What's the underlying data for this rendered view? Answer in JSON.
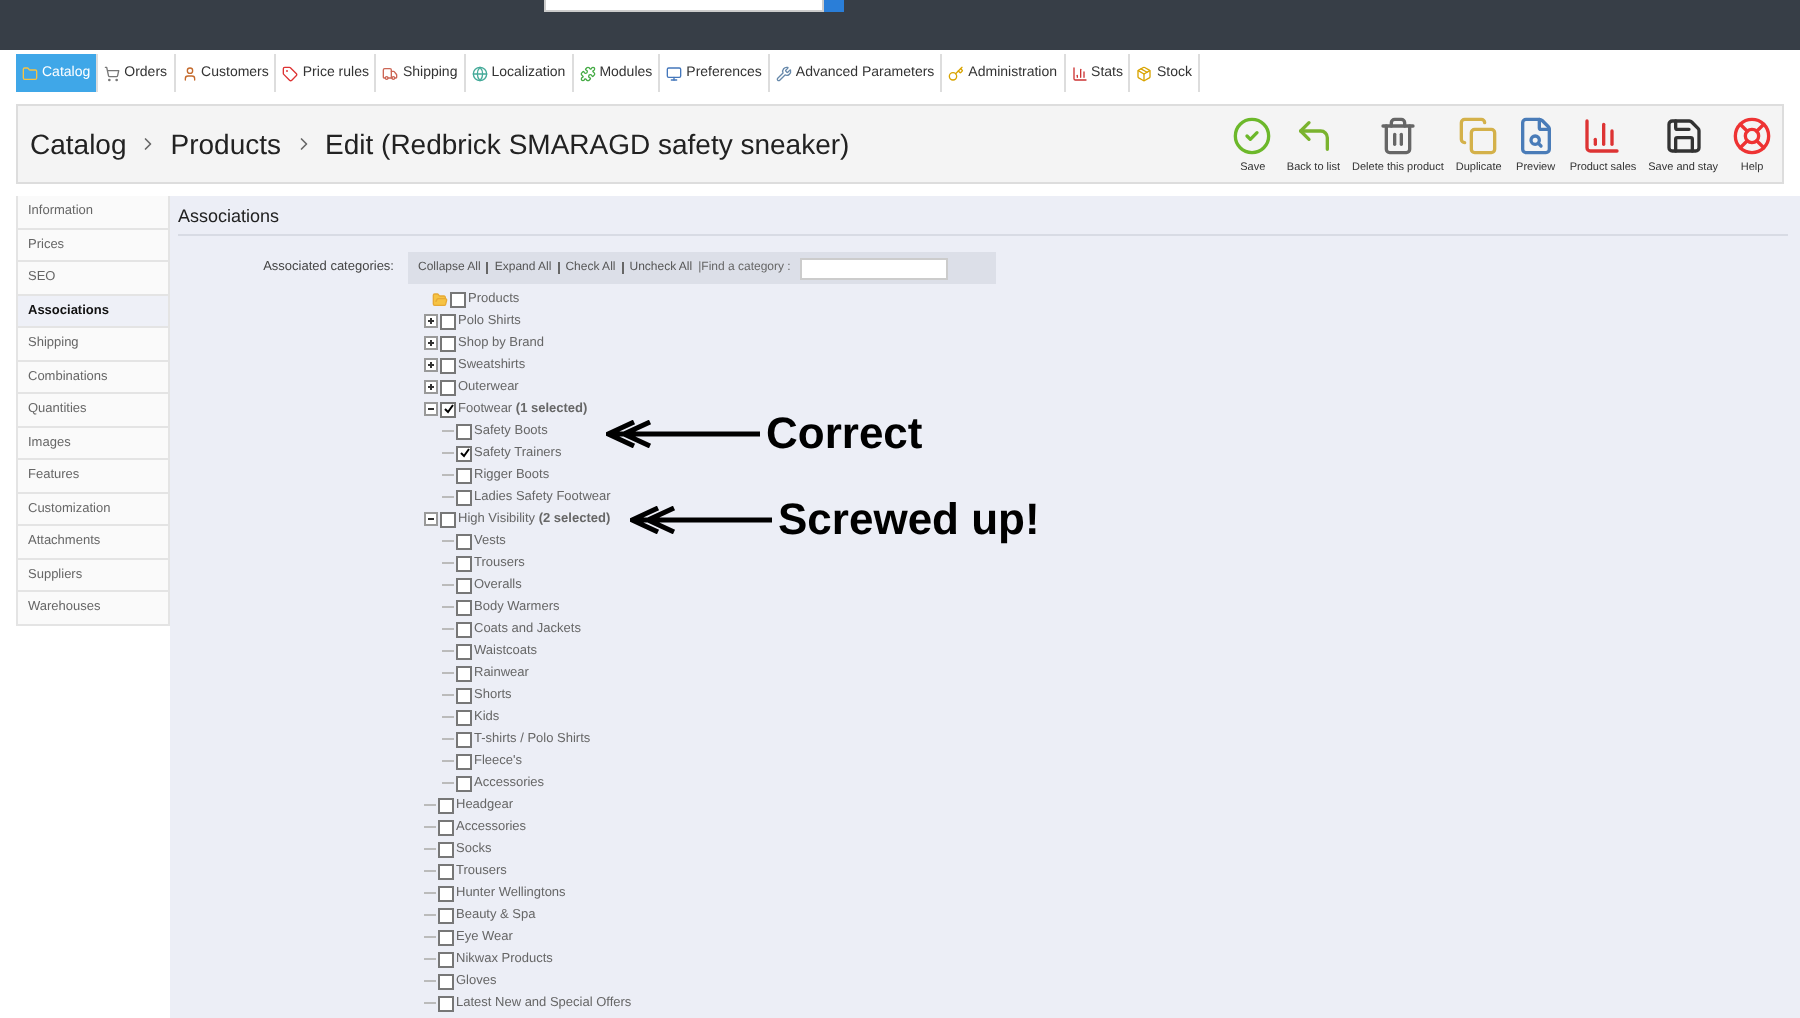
{
  "nav_tabs": [
    {
      "label": "Catalog",
      "selected": true
    },
    {
      "label": "Orders",
      "selected": false
    },
    {
      "label": "Customers",
      "selected": false
    },
    {
      "label": "Price rules",
      "selected": false
    },
    {
      "label": "Shipping",
      "selected": false
    },
    {
      "label": "Localization",
      "selected": false
    },
    {
      "label": "Modules",
      "selected": false
    },
    {
      "label": "Preferences",
      "selected": false
    },
    {
      "label": "Advanced Parameters",
      "selected": false
    },
    {
      "label": "Administration",
      "selected": false
    },
    {
      "label": "Stats",
      "selected": false
    },
    {
      "label": "Stock",
      "selected": false
    }
  ],
  "breadcrumb": [
    "Catalog",
    "Products",
    "Edit (Redbrick SMARAGD safety sneaker)"
  ],
  "toolbar": [
    "Save",
    "Back to list",
    "Delete this product",
    "Duplicate",
    "Preview",
    "Product sales",
    "Save and stay",
    "Help"
  ],
  "sidebar": [
    {
      "label": "Information",
      "selected": false
    },
    {
      "label": "Prices",
      "selected": false
    },
    {
      "label": "SEO",
      "selected": false
    },
    {
      "label": "Associations",
      "selected": true
    },
    {
      "label": "Shipping",
      "selected": false
    },
    {
      "label": "Combinations",
      "selected": false
    },
    {
      "label": "Quantities",
      "selected": false
    },
    {
      "label": "Images",
      "selected": false
    },
    {
      "label": "Features",
      "selected": false
    },
    {
      "label": "Customization",
      "selected": false
    },
    {
      "label": "Attachments",
      "selected": false
    },
    {
      "label": "Suppliers",
      "selected": false
    },
    {
      "label": "Warehouses",
      "selected": false
    }
  ],
  "section_title": "Associations",
  "field_label": "Associated categories:",
  "tree_actions": [
    "Collapse All",
    "Expand All",
    "Check All",
    "Uncheck All"
  ],
  "find_label": "|Find a category :",
  "tree": {
    "label": "Products",
    "checked": false,
    "children": [
      {
        "label": "Polo Shirts",
        "checked": false,
        "expanded": false
      },
      {
        "label": "Shop by Brand",
        "checked": false,
        "expanded": false
      },
      {
        "label": "Sweatshirts",
        "checked": false,
        "expanded": false
      },
      {
        "label": "Outerwear",
        "checked": false,
        "expanded": false
      },
      {
        "label": "Footwear **(1 selected)**",
        "checked": true,
        "expanded": true,
        "children": [
          {
            "label": "Safety Boots",
            "checked": false
          },
          {
            "label": "Safety Trainers",
            "checked": true
          },
          {
            "label": "Rigger Boots",
            "checked": false
          },
          {
            "label": "Ladies Safety Footwear",
            "checked": false
          }
        ]
      },
      {
        "label": "High Visibility **(2 selected)**",
        "checked": false,
        "expanded": true,
        "children": [
          {
            "label": "Vests",
            "checked": false
          },
          {
            "label": "Trousers",
            "checked": false
          },
          {
            "label": "Overalls",
            "checked": false
          },
          {
            "label": "Body Warmers",
            "checked": false
          },
          {
            "label": "Coats and Jackets",
            "checked": false
          },
          {
            "label": "Waistcoats",
            "checked": false
          },
          {
            "label": "Rainwear",
            "checked": false
          },
          {
            "label": "Shorts",
            "checked": false
          },
          {
            "label": "Kids",
            "checked": false
          },
          {
            "label": "T-shirts / Polo Shirts",
            "checked": false
          },
          {
            "label": "Fleece's",
            "checked": false
          },
          {
            "label": "Accessories",
            "checked": false
          }
        ]
      },
      {
        "label": "Headgear",
        "checked": false
      },
      {
        "label": "Accessories",
        "checked": false
      },
      {
        "label": "Socks",
        "checked": false
      },
      {
        "label": "Trousers",
        "checked": false
      },
      {
        "label": "Hunter Wellingtons",
        "checked": false
      },
      {
        "label": "Beauty & Spa",
        "checked": false
      },
      {
        "label": "Eye Wear",
        "checked": false
      },
      {
        "label": "Nikwax Products",
        "checked": false
      },
      {
        "label": "Gloves",
        "checked": false
      },
      {
        "label": "Latest New and Special Offers",
        "checked": false
      }
    ]
  },
  "annotations": [
    "Correct",
    "Screwed up!"
  ]
}
